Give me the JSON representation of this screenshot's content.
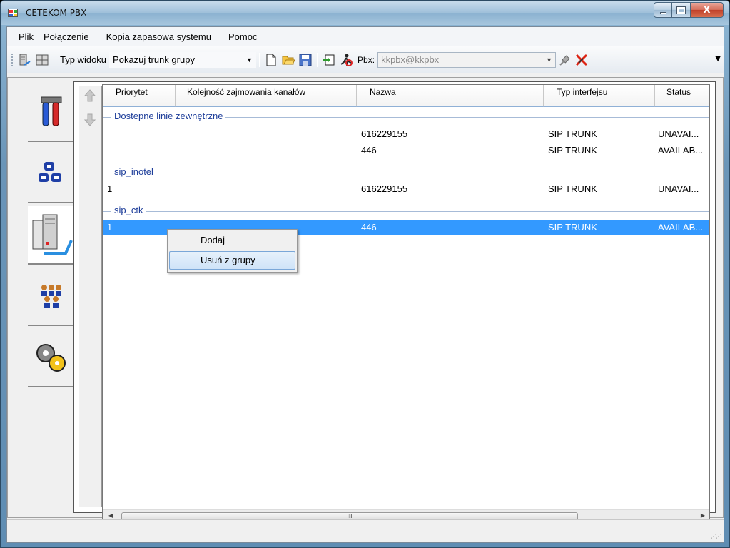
{
  "window": {
    "title": "CETEKOM PBX",
    "min_label": "—",
    "max_label": "□",
    "close_label": "X"
  },
  "menu": {
    "items": [
      "Plik",
      "Połączenie",
      "Kopia zapasowa systemu",
      "Pomoc"
    ]
  },
  "toolbar": {
    "view_type_label": "Typ widoku",
    "view_type_value": "Pokazuj trunk grupy",
    "pbx_label": "Pbx:",
    "pbx_value": "kkpbx@kkpbx"
  },
  "table": {
    "columns": [
      "Priorytet",
      "Kolejność zajmowania kanałów",
      "Nazwa",
      "Typ interfejsu",
      "Status"
    ],
    "groups": [
      {
        "name": "Dostepne linie zewnętrzne",
        "rows": [
          {
            "priority": "",
            "order": "",
            "name": "616229155",
            "type": "SIP TRUNK",
            "status": "UNAVAI..."
          },
          {
            "priority": "",
            "order": "",
            "name": "446",
            "type": "SIP TRUNK",
            "status": "AVAILAB..."
          }
        ]
      },
      {
        "name": "sip_inotel",
        "rows": [
          {
            "priority": "1",
            "order": "",
            "name": "616229155",
            "type": "SIP TRUNK",
            "status": "UNAVAI..."
          }
        ]
      },
      {
        "name": "sip_ctk",
        "rows": [
          {
            "priority": "1",
            "order": "",
            "name": "446",
            "type": "SIP TRUNK",
            "status": "AVAILAB...",
            "selected": true
          }
        ]
      }
    ],
    "scroll_thumb_label": "III"
  },
  "context_menu": {
    "items": [
      "Dodaj",
      "Usuń z grupy"
    ],
    "highlighted": "Usuń z grupy"
  },
  "colors": {
    "selection": "#3399ff",
    "group_header": "#1e3e9a"
  }
}
